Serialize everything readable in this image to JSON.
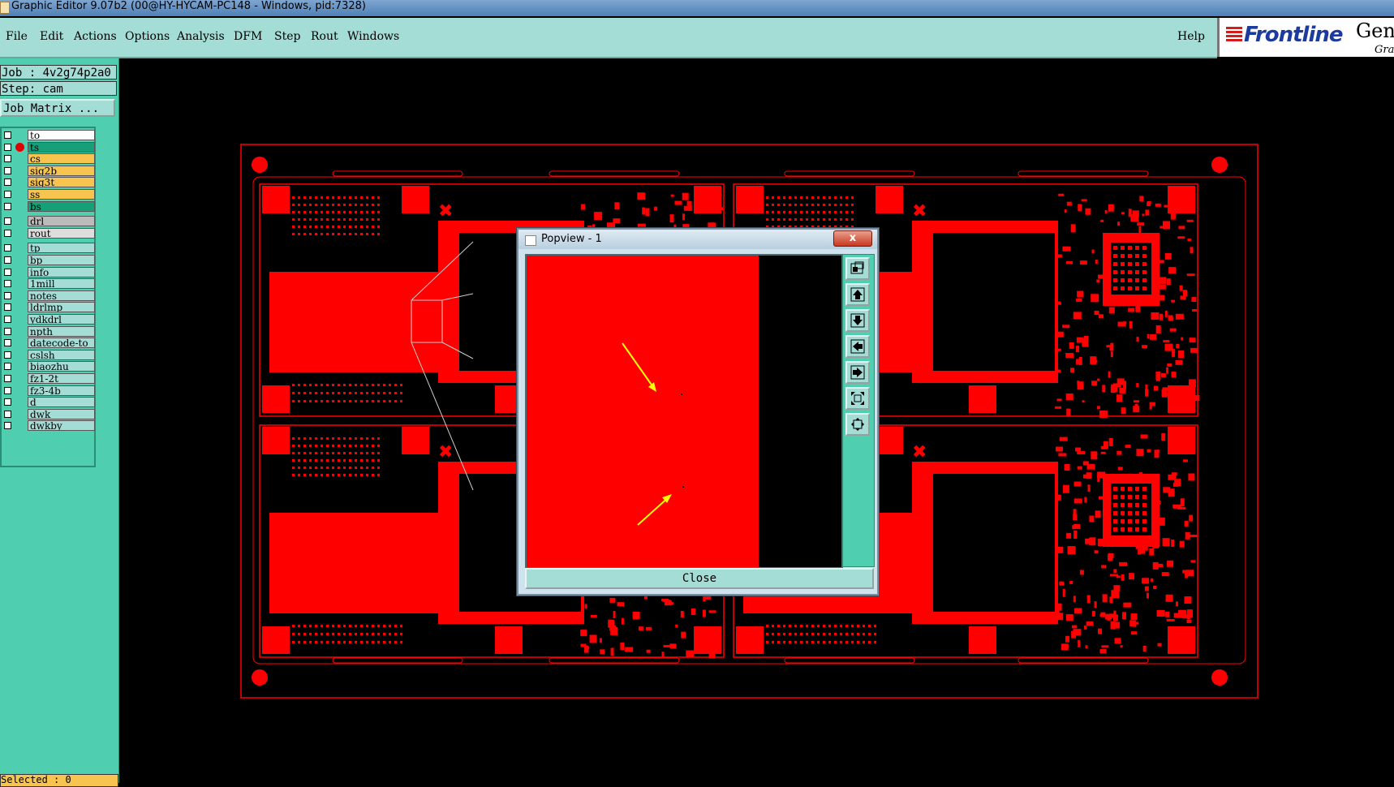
{
  "window": {
    "title": "Graphic Editor 9.07b2 (00@HY-HYCAM-PC148 - Windows, pid:7328)"
  },
  "menubar": {
    "items": [
      "File",
      "Edit",
      "Actions",
      "Options",
      "Analysis",
      "DFM",
      "Step",
      "Rout",
      "Windows"
    ],
    "help": "Help"
  },
  "logo": {
    "brand": "Frontline",
    "product": "Gene",
    "sub": "Grap"
  },
  "left_panel": {
    "job": "Job : 4v2g74p2a0",
    "step": "Step: cam",
    "job_matrix": "Job Matrix ...",
    "selected": "Selected : 0",
    "layers": [
      {
        "name": "to",
        "color": "#ffffff"
      },
      {
        "name": "ts",
        "color": "#15a07a",
        "active": true
      },
      {
        "name": "cs",
        "color": "#f7c450"
      },
      {
        "name": "sig2b",
        "color": "#f7c450"
      },
      {
        "name": "sig3t",
        "color": "#f7c450"
      },
      {
        "name": "ss",
        "color": "#f7c450"
      },
      {
        "name": "bs",
        "color": "#15a07a"
      },
      {
        "name": "drl",
        "color": "#bbbbbb"
      },
      {
        "name": "rout",
        "color": "#dddddd"
      },
      {
        "name": "tp",
        "color": "#a4dcd6"
      },
      {
        "name": "bp",
        "color": "#a4dcd6"
      },
      {
        "name": "info",
        "color": "#a4dcd6"
      },
      {
        "name": "1mill",
        "color": "#a4dcd6"
      },
      {
        "name": "notes",
        "color": "#a4dcd6"
      },
      {
        "name": "ldrlmp",
        "color": "#a4dcd6"
      },
      {
        "name": "ydkdrl",
        "color": "#a4dcd6"
      },
      {
        "name": "npth",
        "color": "#a4dcd6"
      },
      {
        "name": "datecode-to",
        "color": "#a4dcd6"
      },
      {
        "name": "cslsh",
        "color": "#a4dcd6"
      },
      {
        "name": "biaozhu",
        "color": "#a4dcd6"
      },
      {
        "name": "fz1-2t",
        "color": "#a4dcd6"
      },
      {
        "name": "fz3-4b",
        "color": "#a4dcd6"
      },
      {
        "name": "d",
        "color": "#a4dcd6"
      },
      {
        "name": "dwk",
        "color": "#a4dcd6"
      },
      {
        "name": "dwkby",
        "color": "#a4dcd6"
      }
    ]
  },
  "popview": {
    "title": "Popview - 1",
    "close_x": "x",
    "close_button": "Close",
    "tools": [
      "zoom-fit-icon",
      "pan-up-icon",
      "pan-down-icon",
      "pan-left-icon",
      "pan-right-icon",
      "zoom-in-icon",
      "zoom-out-icon"
    ]
  },
  "colors": {
    "board": "#ff0000",
    "outline": "#ff0000",
    "arrow": "#ffff00",
    "panel": "#4fcfb0",
    "menubar": "#a4dcd6"
  }
}
